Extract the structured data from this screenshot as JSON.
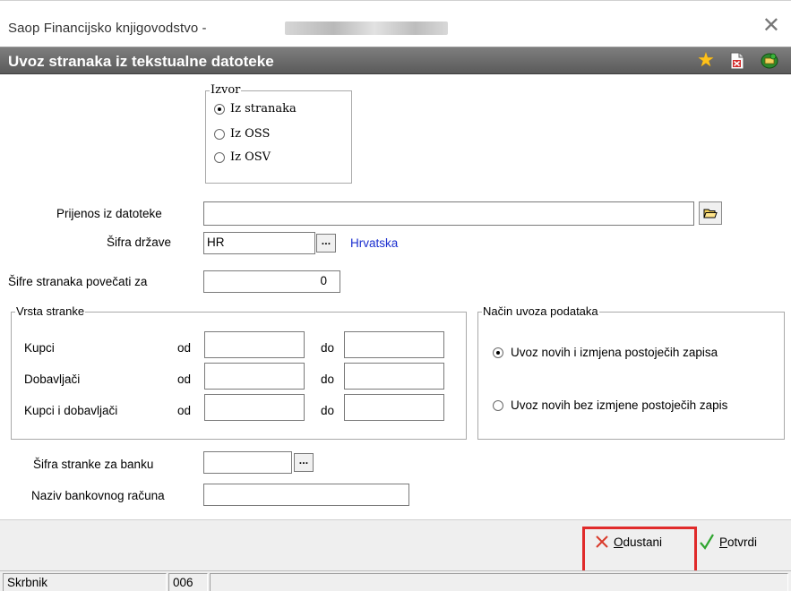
{
  "window": {
    "title": "Saop Financijsko knjigovodstvo -",
    "close_icon": "close-icon"
  },
  "header": {
    "title": "Uvoz stranaka iz tekstualne datoteke",
    "icons": [
      "star-icon",
      "document-close-icon",
      "exit-icon"
    ]
  },
  "source_group": {
    "legend": "Izvor",
    "options": [
      {
        "label": "Iz stranaka",
        "checked": true
      },
      {
        "label": "Iz OSS",
        "checked": false
      },
      {
        "label": "Iz OSV",
        "checked": false
      }
    ]
  },
  "fields": {
    "file_label": "Prijenos iz datoteke",
    "file_value": "",
    "country_label": "Šifra države",
    "country_value": "HR",
    "country_name": "Hrvatska",
    "increase_label": "Šifre stranaka povečati za",
    "increase_value": "0",
    "bank_code_label": "Šifra stranke za banku",
    "bank_code_value": "",
    "bank_account_label": "Naziv bankovnog računa",
    "bank_account_value": ""
  },
  "party_type_group": {
    "legend": "Vrsta stranke",
    "from_label": "od",
    "to_label": "do",
    "rows": [
      {
        "label": "Kupci",
        "from": "",
        "to": ""
      },
      {
        "label": "Dobavljači",
        "from": "",
        "to": ""
      },
      {
        "label": "Kupci i dobavljači",
        "from": "",
        "to": ""
      }
    ]
  },
  "import_mode_group": {
    "legend": "Način uvoza podataka",
    "options": [
      {
        "label": "Uvoz novih i izmjena postoječih zapisa",
        "checked": true
      },
      {
        "label": "Uvoz novih bez izmjene postoječih zapis",
        "checked": false
      }
    ]
  },
  "footer": {
    "cancel_label_underlined": "O",
    "cancel_label_rest": "dustani",
    "confirm_label_underlined": "P",
    "confirm_label_rest": "otvrdi"
  },
  "status": {
    "user": "Skrbnik",
    "code": "006"
  },
  "colors": {
    "header_bg": "#6b6b6b",
    "link": "#1a2ecf",
    "highlight": "#e02a2a",
    "confirm_check": "#2fa52f",
    "cancel_x": "#d93a2a"
  }
}
